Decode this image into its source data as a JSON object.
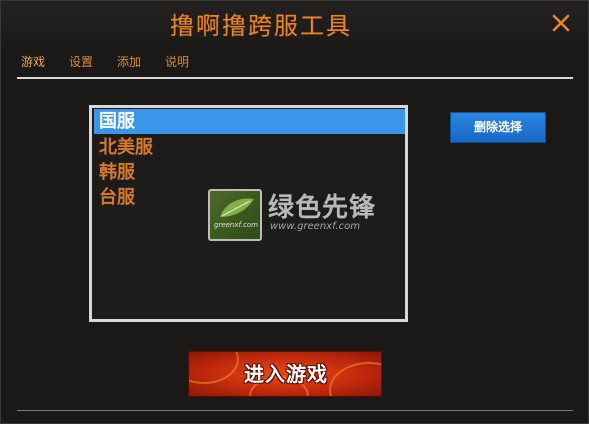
{
  "window": {
    "title": "撸啊撸跨服工具"
  },
  "menu": {
    "items": [
      {
        "label": "游戏"
      },
      {
        "label": "设置"
      },
      {
        "label": "添加"
      },
      {
        "label": "说明"
      }
    ]
  },
  "server_list": {
    "items": [
      {
        "label": "国服",
        "selected": true
      },
      {
        "label": "北美服",
        "selected": false
      },
      {
        "label": "韩服",
        "selected": false
      },
      {
        "label": "台服",
        "selected": false
      }
    ]
  },
  "watermark": {
    "title": "绿色先锋",
    "url": "www.greenxf.com",
    "badge_text": "greenxf.com"
  },
  "buttons": {
    "delete_label": "删除选择",
    "enter_label": "进入游戏"
  },
  "colors": {
    "accent_orange": "#e8862a",
    "selection_blue": "#3a96e8",
    "button_blue": "#1f78d6",
    "enter_red": "#c32a0c"
  },
  "icons": {
    "close": "close-icon"
  }
}
